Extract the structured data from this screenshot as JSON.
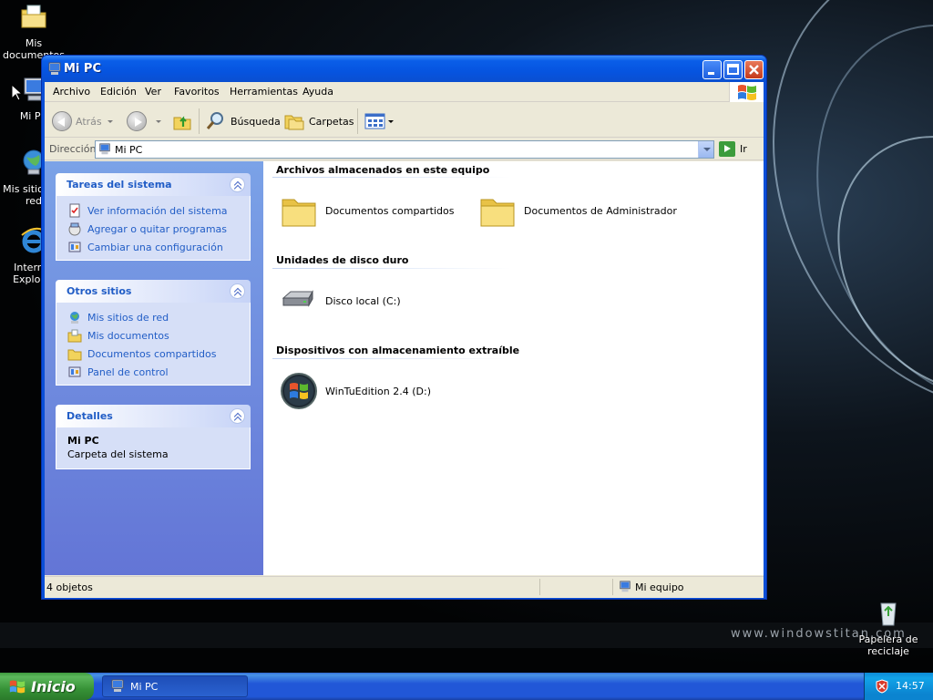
{
  "desktop": {
    "icons": [
      {
        "name": "mis-documentos",
        "label": "Mis documentos"
      },
      {
        "name": "mi-pc",
        "label": "Mi PC"
      },
      {
        "name": "mis-sitios",
        "label": "Mis sitios de red"
      },
      {
        "name": "internet-explorer",
        "label": "Internet Explorer"
      },
      {
        "name": "papelera",
        "label": "Papelera de reciclaje"
      }
    ],
    "watermark": "www.windowstitan.com"
  },
  "window": {
    "title": "Mi PC",
    "menu": [
      "Archivo",
      "Edición",
      "Ver",
      "Favoritos",
      "Herramientas",
      "Ayuda"
    ],
    "toolbar": {
      "back_label": "Atrás",
      "search_label": "Búsqueda",
      "folders_label": "Carpetas"
    },
    "address": {
      "label": "Dirección",
      "value": "Mi PC",
      "go_label": "Ir"
    },
    "taskpane": {
      "system_tasks": {
        "title": "Tareas del sistema",
        "items": [
          "Ver información del sistema",
          "Agregar o quitar programas",
          "Cambiar una configuración"
        ]
      },
      "other_places": {
        "title": "Otros sitios",
        "items": [
          "Mis sitios de red",
          "Mis documentos",
          "Documentos compartidos",
          "Panel de control"
        ]
      },
      "details": {
        "title": "Detalles",
        "name": "Mi PC",
        "type": "Carpeta del sistema"
      }
    },
    "groups": [
      {
        "title": "Archivos almacenados en este equipo",
        "items": [
          "Documentos compartidos",
          "Documentos de Administrador"
        ]
      },
      {
        "title": "Unidades de disco duro",
        "items": [
          "Disco local (C:)"
        ]
      },
      {
        "title": "Dispositivos con almacenamiento extraíble",
        "items": [
          "WinTuEdition 2.4 (D:)"
        ]
      }
    ],
    "status": {
      "count": "4 objetos",
      "location": "Mi equipo"
    }
  },
  "taskbar": {
    "start_label": "Inicio",
    "task_label": "Mi PC",
    "clock": "14:57"
  }
}
